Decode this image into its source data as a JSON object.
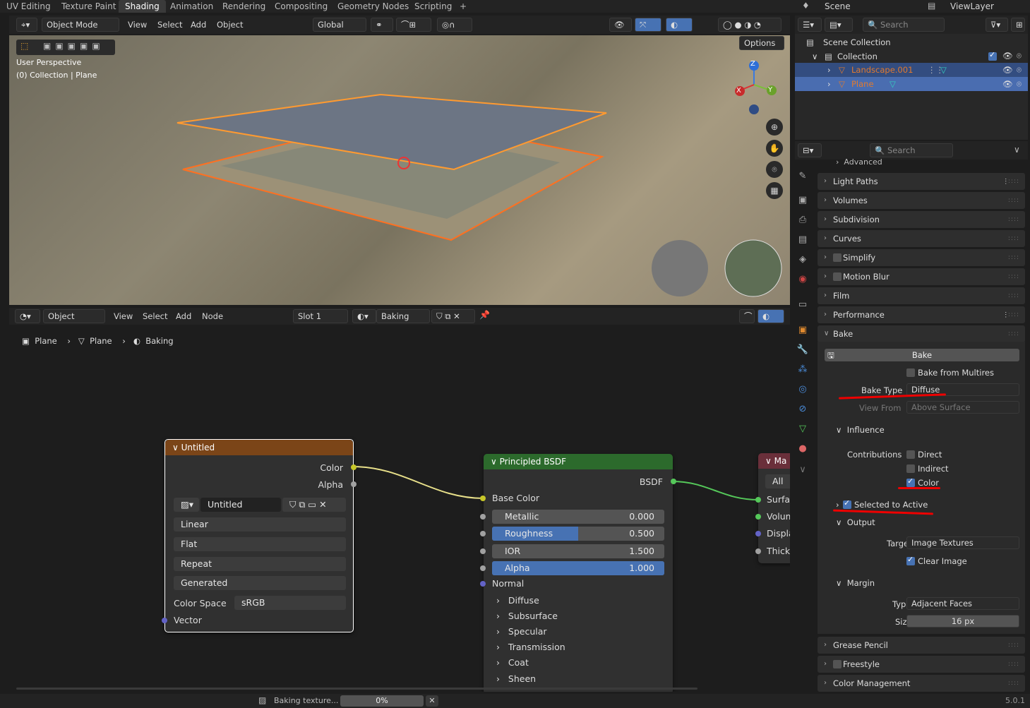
{
  "workspace_tabs": [
    "UV Editing",
    "Texture Paint",
    "Shading",
    "Animation",
    "Rendering",
    "Compositing",
    "Geometry Nodes",
    "Scripting",
    "+"
  ],
  "active_tab": "Shading",
  "scene": {
    "scene_label": "Scene",
    "viewlayer_label": "ViewLayer"
  },
  "viewport": {
    "mode": "Object Mode",
    "menus": [
      "View",
      "Select",
      "Add",
      "Object"
    ],
    "transform": "Global",
    "options": "Options",
    "info_line1": "User Perspective",
    "info_line2": "(0) Collection | Plane",
    "axes": {
      "z": "Z",
      "x": "X",
      "y": "Y"
    }
  },
  "outliner": {
    "search_placeholder": "Search",
    "root": "Scene Collection",
    "collection": "Collection",
    "items": [
      {
        "name": "Landscape.001",
        "color": "#e07a2f"
      },
      {
        "name": "Plane",
        "color": "#e07a2f"
      }
    ]
  },
  "node_editor": {
    "type": "Object",
    "menus": [
      "View",
      "Select",
      "Add",
      "Node"
    ],
    "slot": "Slot 1",
    "material": "Baking",
    "breadcrumb": [
      "Plane",
      "Plane",
      "Baking"
    ]
  },
  "image_node": {
    "title": "Untitled",
    "header_color": "#7b4518",
    "outputs": [
      "Color",
      "Alpha"
    ],
    "image_name": "Untitled",
    "interpolation": "Linear",
    "projection": "Flat",
    "extension": "Repeat",
    "source": "Generated",
    "color_space_label": "Color Space",
    "color_space": "sRGB",
    "input": "Vector"
  },
  "bsdf_node": {
    "title": "Principled BSDF",
    "header_color": "#2c6a2c",
    "output": "BSDF",
    "base_color": "Base Color",
    "fields": [
      {
        "label": "Metallic",
        "value": "0.000",
        "fill": 0.0
      },
      {
        "label": "Roughness",
        "value": "0.500",
        "fill": 0.5
      },
      {
        "label": "IOR",
        "value": "1.500",
        "fill": 0.0
      },
      {
        "label": "Alpha",
        "value": "1.000",
        "fill": 1.0
      }
    ],
    "normal": "Normal",
    "panels": [
      "Diffuse",
      "Subsurface",
      "Specular",
      "Transmission",
      "Coat",
      "Sheen"
    ]
  },
  "output_node": {
    "title": "Ma",
    "header_color": "#6a2f3a",
    "target": "All",
    "inputs": [
      "Surfa",
      "Volum",
      "Displa",
      "Thick"
    ]
  },
  "properties": {
    "search_placeholder": "Search",
    "advanced": "Advanced",
    "panels": [
      "Light Paths",
      "Volumes",
      "Subdivision",
      "Curves",
      "Simplify",
      "Motion Blur",
      "Film",
      "Performance",
      "Bake"
    ],
    "bake_button": "Bake",
    "bake_from_multires": "Bake from Multires",
    "bake_type_label": "Bake Type",
    "bake_type": "Diffuse",
    "view_from_label": "View From",
    "view_from": "Above Surface",
    "influence": "Influence",
    "contributions_label": "Contributions",
    "direct": "Direct",
    "indirect": "Indirect",
    "color": "Color",
    "selected_to_active": "Selected to Active",
    "output": "Output",
    "target_label": "Target",
    "target": "Image Textures",
    "clear_image": "Clear Image",
    "margin": "Margin",
    "type_label": "Type",
    "type": "Adjacent Faces",
    "size_label": "Size",
    "size": "16 px",
    "bottom_panels": [
      "Grease Pencil",
      "Freestyle",
      "Color Management"
    ]
  },
  "status": {
    "baking_text": "Baking texture...",
    "progress": "0%",
    "progress_value": 0.0,
    "version": "5.0.1"
  }
}
